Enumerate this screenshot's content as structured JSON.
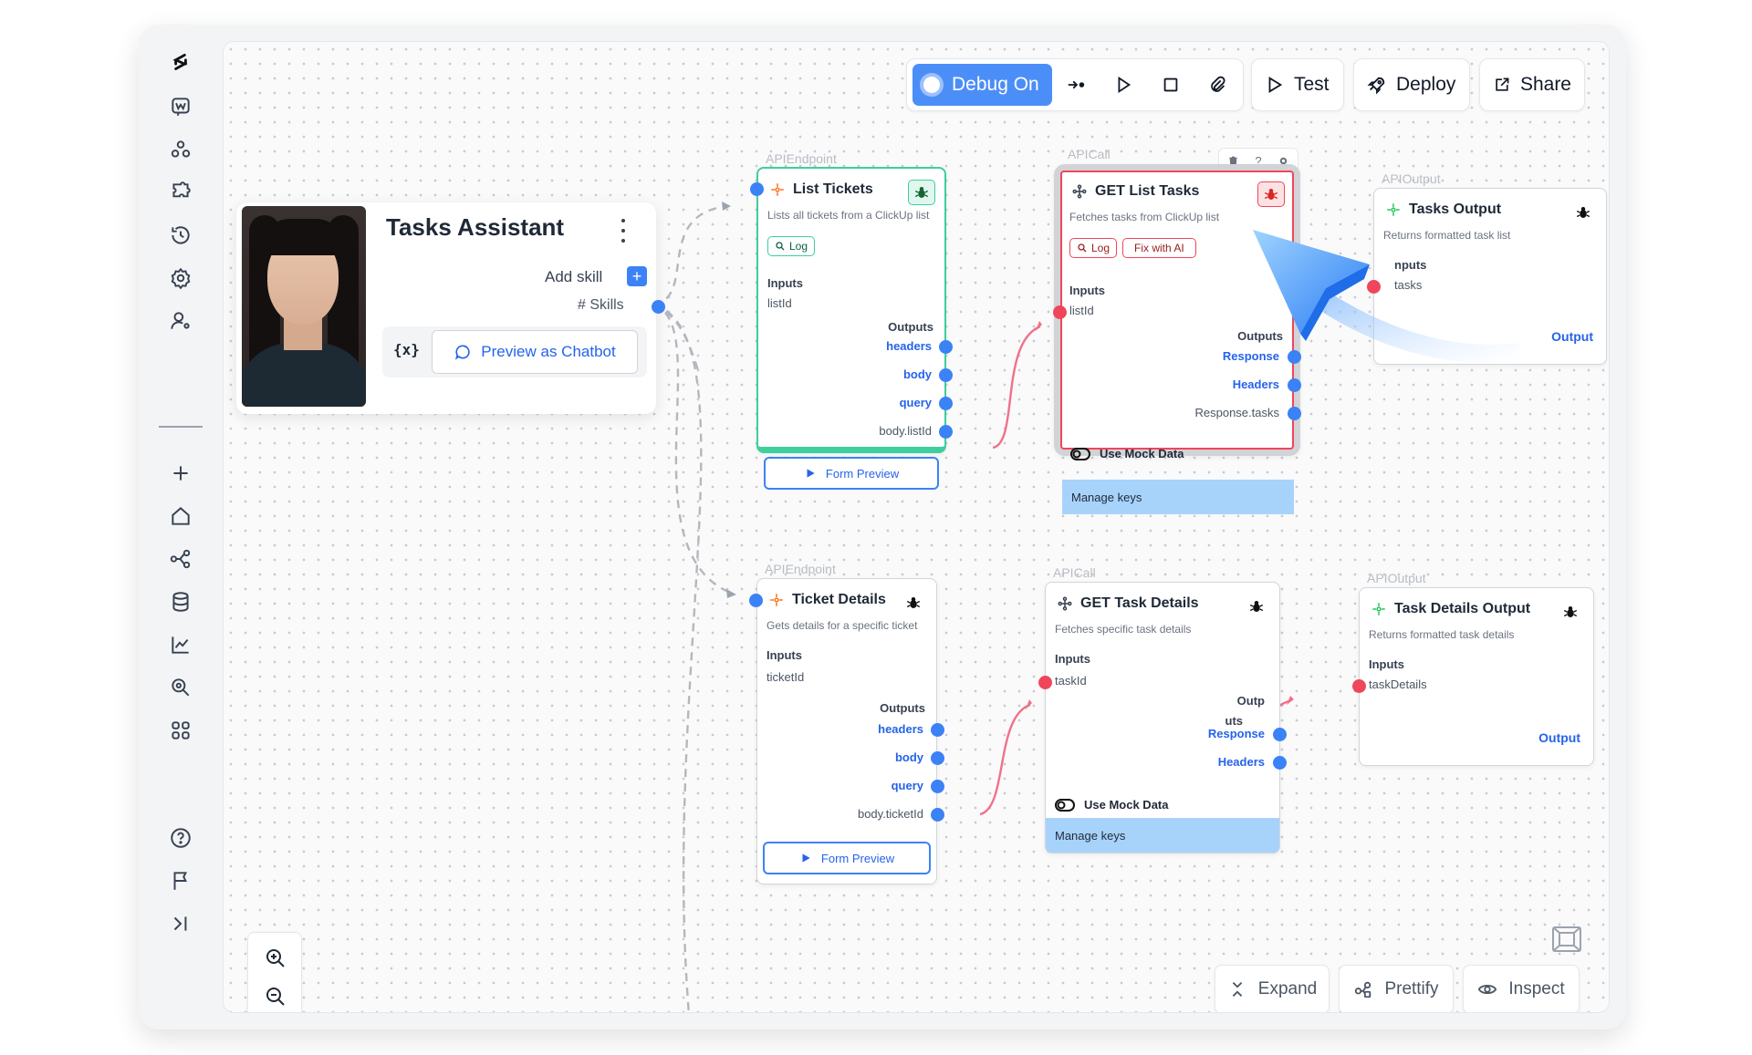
{
  "toolbar": {
    "debug_label": "Debug On",
    "test_label": "Test",
    "deploy_label": "Deploy",
    "share_label": "Share"
  },
  "agent": {
    "name": "Tasks Assistant",
    "add_skill_label": "Add skill",
    "add_skill_plus": "+",
    "skills_label": "# Skills",
    "vars_label": "{x}",
    "preview_label": "Preview as Chatbot"
  },
  "nodes": {
    "list_tickets": {
      "type": "APIEndpoint",
      "title": "List Tickets",
      "desc": "Lists all tickets from a ClickUp list",
      "log": "Log",
      "inputs_label": "Inputs",
      "input": "listId",
      "outputs_label": "Outputs",
      "outputs": [
        "headers",
        "body",
        "query",
        "body.listId"
      ],
      "form_preview": "Form Preview"
    },
    "get_list_tasks": {
      "type": "APICall",
      "title": "GET List Tasks",
      "desc": "Fetches tasks from ClickUp list",
      "log": "Log",
      "fix": "Fix with AI",
      "inputs_label": "Inputs",
      "input": "listId",
      "outputs_label": "Outputs",
      "outputs": [
        "Response",
        "Headers",
        "Response.tasks"
      ],
      "mock": "Use Mock Data",
      "manage": "Manage keys"
    },
    "tasks_output": {
      "type": "APIOutput",
      "title": "Tasks Output",
      "desc": "Returns formatted task list",
      "inputs_label": "nputs",
      "input": "tasks",
      "output": "Output"
    },
    "ticket_details": {
      "type": "APIEndpoint",
      "title": "Ticket Details",
      "desc": "Gets details for a specific ticket",
      "inputs_label": "Inputs",
      "input": "ticketId",
      "outputs_label": "Outputs",
      "outputs": [
        "headers",
        "body",
        "query",
        "body.ticketId"
      ],
      "form_preview": "Form Preview"
    },
    "get_task_details": {
      "type": "APICall",
      "title": "GET Task Details",
      "desc": "Fetches specific task details",
      "inputs_label": "Inputs",
      "input": "taskId",
      "outputs_label_a": "Outp",
      "outputs_label_b": "uts",
      "outputs": [
        "Response",
        "Headers"
      ],
      "mock": "Use Mock Data",
      "manage": "Manage keys"
    },
    "task_details_output": {
      "type": "APIOutput",
      "title": "Task Details Output",
      "desc": "Returns formatted task details",
      "inputs_label": "Inputs",
      "input": "taskDetails",
      "output": "Output"
    }
  },
  "node_tools": [
    "trash-icon",
    "question-icon",
    "gear-icon"
  ],
  "node_tools_help": "?",
  "bottom": {
    "expand_label": "Expand",
    "prettify_label": "Prettify",
    "inspect_label": "Inspect"
  },
  "colors": {
    "accent": "#3b82f6",
    "debug": "#4c8ef7",
    "error": "#f0465b",
    "success": "#3ecf9e",
    "manage_bar": "#a7d3fb"
  }
}
